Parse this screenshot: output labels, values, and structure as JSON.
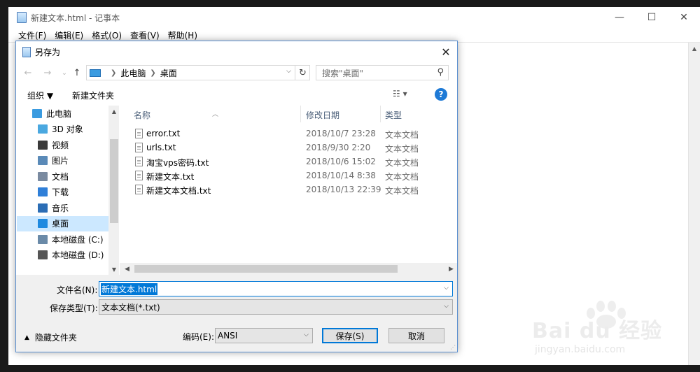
{
  "notepad": {
    "title": "新建文本.html - 记事本",
    "controls": {
      "minimize": "—",
      "maximize": "☐",
      "close": "✕"
    },
    "menus": [
      "文件(F)",
      "编辑(E)",
      "格式(O)",
      "查看(V)",
      "帮助(H)"
    ]
  },
  "dialog": {
    "title": "另存为",
    "close": "✕",
    "nav": {
      "back": "←",
      "forward": "→",
      "recent": "⌄",
      "up": "↑"
    },
    "address": {
      "segments": [
        "此电脑",
        "桌面"
      ]
    },
    "search": {
      "placeholder": "搜索\"桌面\""
    },
    "toolbar": {
      "organize": "组织 ▼",
      "new_folder": "新建文件夹",
      "help": "?"
    },
    "tree": [
      {
        "label": "此电脑",
        "icon": "pc-icon",
        "color": "#3a9be0",
        "root": true
      },
      {
        "label": "3D 对象",
        "icon": "3d-objects-icon",
        "color": "#4aa8e0"
      },
      {
        "label": "视频",
        "icon": "video-icon",
        "color": "#3a3a3a"
      },
      {
        "label": "图片",
        "icon": "pictures-icon",
        "color": "#5a8ab8"
      },
      {
        "label": "文档",
        "icon": "documents-icon",
        "color": "#7a8aa0"
      },
      {
        "label": "下载",
        "icon": "download-icon",
        "color": "#2f7fd8"
      },
      {
        "label": "音乐",
        "icon": "music-icon",
        "color": "#2b6db5"
      },
      {
        "label": "桌面",
        "icon": "desktop-icon",
        "color": "#1f8ae0",
        "selected": true
      },
      {
        "label": "本地磁盘 (C:)",
        "icon": "drive-c-icon",
        "color": "#6a8aa8"
      },
      {
        "label": "本地磁盘 (D:)",
        "icon": "drive-d-icon",
        "color": "#555555"
      }
    ],
    "columns": {
      "name": "名称",
      "date": "修改日期",
      "type": "类型"
    },
    "files": [
      {
        "name": "error.txt",
        "date": "2018/10/7 23:28",
        "type": "文本文档"
      },
      {
        "name": "urls.txt",
        "date": "2018/9/30 2:20",
        "type": "文本文档"
      },
      {
        "name": "淘宝vps密码.txt",
        "date": "2018/10/6 15:02",
        "type": "文本文档"
      },
      {
        "name": "新建文本.txt",
        "date": "2018/10/14 8:38",
        "type": "文本文档"
      },
      {
        "name": "新建文本文档.txt",
        "date": "2018/10/13 22:39",
        "type": "文本文档"
      }
    ],
    "filename": {
      "label": "文件名(N):",
      "value": "新建文本.html"
    },
    "filetype": {
      "label": "保存类型(T):",
      "value": "文本文档(*.txt)"
    },
    "hide_folders": "隐藏文件夹",
    "encoding": {
      "label": "编码(E):",
      "value": "ANSI"
    },
    "save": "保存(S)",
    "cancel": "取消"
  },
  "watermark": {
    "brand": "Bai du 经验",
    "sub": "jingyan.baidu.com"
  },
  "colors": {
    "accent": "#0078d7",
    "selection": "#cce8ff",
    "dialog_border": "#5a8fd0"
  }
}
